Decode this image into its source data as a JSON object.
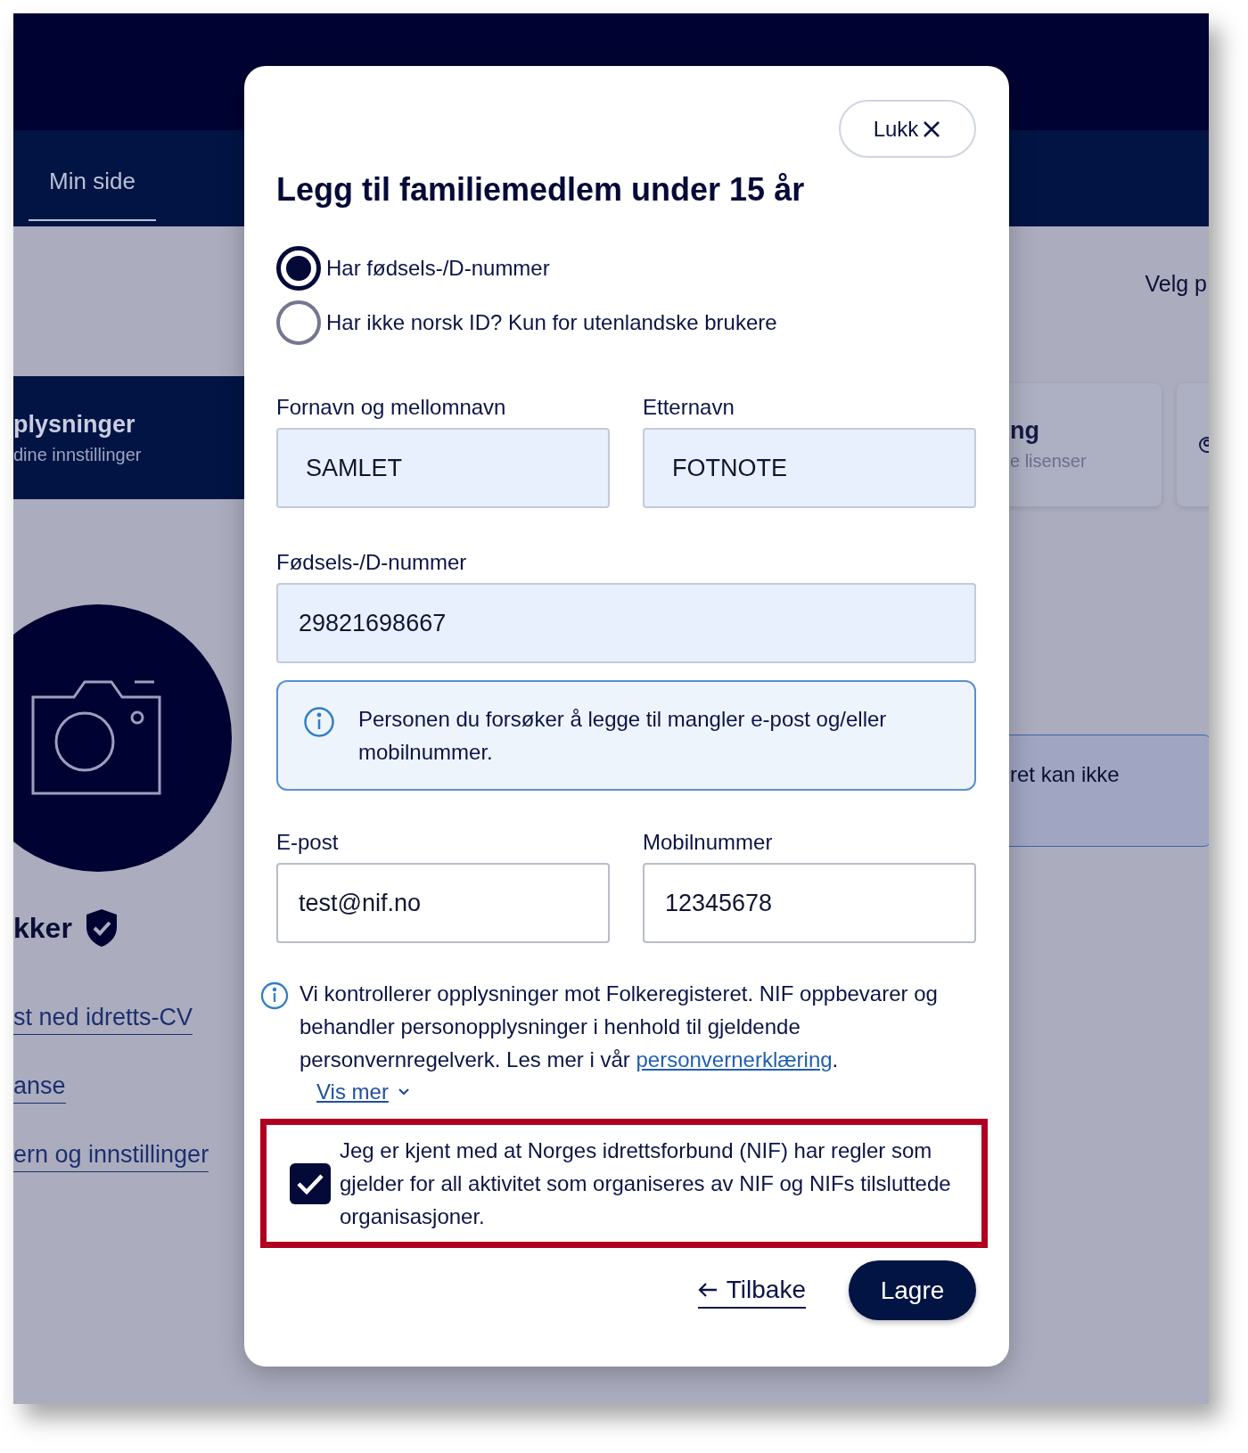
{
  "background": {
    "nav_tab": {
      "label": "Min side",
      "selected": true
    },
    "profile_card": {
      "title": "plysninger",
      "subtitle": "dine innstillinger"
    },
    "user_name": "kker",
    "verified": true,
    "links": [
      "st ned idretts-CV",
      "anse",
      "ern og innstillinger"
    ],
    "select_label": "Velg p",
    "license_card": {
      "title": "ng",
      "subtitle": "e lisenser"
    },
    "alert_text": "ret kan ikke"
  },
  "modal": {
    "close_button": {
      "label": "Lukk"
    },
    "title": "Legg til familiemedlem under 15 år",
    "radios": [
      {
        "label": "Har fødsels-/D-nummer",
        "selected": true
      },
      {
        "label": "Har ikke norsk ID? Kun for utenlandske brukere",
        "selected": false
      }
    ],
    "name_fields": [
      {
        "label": "Fornavn og mellomnavn",
        "value": "SAMLET",
        "autofilled": true
      },
      {
        "label": "Etternavn",
        "value": "FOTNOTE",
        "autofilled": true
      }
    ],
    "id_field": {
      "label": "Fødsels-/D-nummer",
      "value": "29821698667",
      "autofilled": true
    },
    "info_box": {
      "text": "Personen du forsøker å legge til mangler e-post og/eller mobilnummer."
    },
    "contact_fields": [
      {
        "label": "E-post",
        "value": "test@nif.no",
        "autofilled": false
      },
      {
        "label": "Mobilnummer",
        "value": "12345678",
        "autofilled": false
      }
    ],
    "privacy_notice": {
      "text": "Vi kontrollerer opplysninger mot Folkeregisteret. NIF oppbevarer og behandler personopplysninger i henhold til gjeldende personvernregelverk. Les mer i vår ",
      "link": "personvernerklæring",
      "after": "."
    },
    "show_more": {
      "label": "Vis mer",
      "expanded": false
    },
    "consent": {
      "text": "Jeg er kjent med at Norges idrettsforbund (NIF) har regler som gjelder for all aktivitet som organiseres av NIF og NIFs tilsluttede organisasjoner.",
      "checked": true,
      "highlighted": true
    },
    "back_link": {
      "label": "Tilbake"
    },
    "save_button": {
      "label": "Lagre"
    }
  }
}
